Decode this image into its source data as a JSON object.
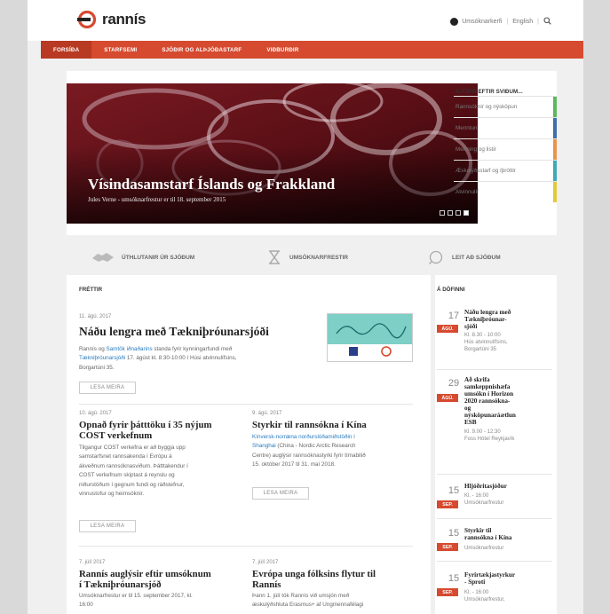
{
  "header": {
    "logo_text": "rannís",
    "utility": {
      "apply": "Umsóknarkerfi",
      "lang": "English",
      "sep": "|"
    }
  },
  "nav": {
    "items": [
      "FORSÍÐA",
      "STARFSEMI",
      "SJÓÐIR OG ALÞJÓÐASTARF",
      "VIÐBURÐIR"
    ]
  },
  "hero": {
    "title": "Vísindasamstarf Íslands og Frakkland",
    "subtitle": "Jules Verne - umsóknarfrestur er til 18. september 2015"
  },
  "funds": {
    "heading": "SJÓÐIR EFTIR SVIÐUM...",
    "items": [
      {
        "label": "Rannsóknir og nýsköpun",
        "color": "#5cb85c"
      },
      {
        "label": "Menntun",
        "color": "#3f6fa8"
      },
      {
        "label": "Menning og listir",
        "color": "#e8944a"
      },
      {
        "label": "Æskulýðsstarf og íþróttir",
        "color": "#3fa9b5"
      },
      {
        "label": "Atvinnulíf",
        "color": "#e2c93a"
      }
    ]
  },
  "quick": {
    "grants": "ÚTHLUTANIR ÚR SJÓÐUM",
    "deadlines": "UMSÓKNARFRESTIR",
    "search": "LEIT AÐ SJÓÐUM"
  },
  "news": {
    "heading": "FRÉTTIR",
    "read_more": "LESA MEIRA",
    "featured": {
      "date": "11. ágú. 2017",
      "title": "Náðu lengra með Tækniþróunarsjóði",
      "body_pre": "Rannís og ",
      "body_link1": "Samtök iðnaðarins",
      "body_mid": " standa fyrir kynningarfundi með",
      "body_link2": "Tækniþróunarsjóði",
      "body_post": " 17. ágúst kl. 8:30-10:00 í Húsi atvinnulífsins,",
      "body_last": "Borgartúni 35."
    },
    "items": [
      {
        "date": "10. ágú. 2017",
        "title1": "Opnað fyrir þátttöku í 35 nýjum",
        "title2": "COST verkefnum",
        "lines": [
          "Tilgangur COST verkefna er að byggja upp",
          "samstarfsnet rannsakenda í Evrópu á",
          "ákveðnum rannsóknasviðum. Þátttakendur í",
          "COST verkefnum skiptast á reynslu og",
          "niðurstöðum í gegnum fundi og ráðstefnur,",
          "vinnustofur og heimsóknir."
        ]
      },
      {
        "date": "9. ágú. 2017",
        "title1": "Styrkir til rannsókna í Kína",
        "lines_link": [
          "Kínversk-norræna norðurslóðamiðstöðin í",
          "Shanghai"
        ],
        "lines_tail": " (China - Nordic Arctic Research",
        "lines": [
          "Centre) auglýsir rannsóknastyrki fyrir tímabilið",
          "15. október 2017 til 31. maí 2018."
        ]
      },
      {
        "date": "7. júlí 2017",
        "title1": "Rannís auglýsir eftir umsóknum",
        "title2": "í Tækniþróunarsjóð",
        "lines": [
          "Umsóknarfrestur er til 15. september 2017, kl.",
          "16:00"
        ]
      },
      {
        "date": "7. júlí 2017",
        "title1": "Evrópa unga fólksins flytur til",
        "title2": "Rannís",
        "lines": [
          "Þann 1. júlí tók Rannís við umsjón með",
          "æskulýðshluta Erasmus+ af Ungmennafélagi"
        ]
      }
    ]
  },
  "calendar": {
    "heading": "Á DÖFINNI",
    "events": [
      {
        "day": "17",
        "mon": "ÁGÚ.",
        "title": [
          "Náðu lengra með",
          "Tækniþróunar-",
          "sjóði"
        ],
        "details": [
          "Kl. 8.30 - 10:00",
          "Hús atvinnulífsins,",
          "Borgartúni 35"
        ]
      },
      {
        "day": "29",
        "mon": "ÁGÚ.",
        "title": [
          "Að skrifa",
          "samkeppnishæfa",
          "umsókn í Horizon",
          "2020 rannsókna-",
          "og",
          "nýsköpunaráætlun",
          "ESB"
        ],
        "details": [
          "Kl. 9.00 - 12:30",
          "Foss Hótel Reykjavík"
        ]
      },
      {
        "day": "15",
        "mon": "SEP.",
        "title": [
          "Hljóðritasjóður"
        ],
        "details": [
          "Kl. - 16:00",
          "Umsóknarfrestur"
        ]
      },
      {
        "day": "15",
        "mon": "SEP.",
        "title": [
          "Styrkir til",
          "rannsókna í Kína"
        ],
        "details": [
          "Umsóknarfrestur"
        ]
      },
      {
        "day": "15",
        "mon": "SEP.",
        "title": [
          "Fyrirtækjastyrkur",
          "- Sproti"
        ],
        "details": [
          "Kl. - 16:00",
          "Umsóknarfrestur,"
        ]
      }
    ]
  }
}
